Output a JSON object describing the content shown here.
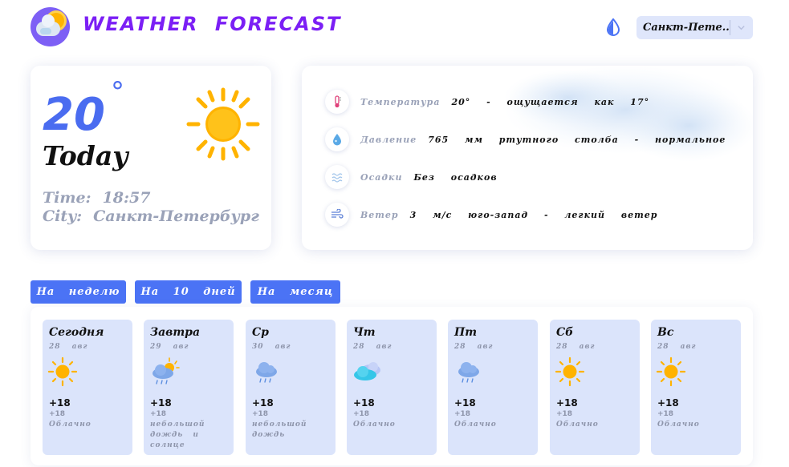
{
  "header": {
    "app_title": "WEATHER FORECAST",
    "city_selected": "Санкт-Пете...",
    "theme_icon": "droplet-half-icon"
  },
  "today": {
    "temperature": "20",
    "degree": "°",
    "label": "Today",
    "time_label": "Time:",
    "time_value": "18:57",
    "city_label": "City:",
    "city_value": "Санкт-Петербург",
    "icon": "sun-icon"
  },
  "details": [
    {
      "icon": "thermometer-icon",
      "label": "Температура",
      "value": "20° - ощущается как 17°"
    },
    {
      "icon": "pressure-drop-icon",
      "label": "Давление",
      "value": "765 мм ртутного столба - нормальное"
    },
    {
      "icon": "precipitation-icon",
      "label": "Осадки",
      "value": "Без осадков"
    },
    {
      "icon": "wind-icon",
      "label": "Ветер",
      "value": "3 м/с юго-запад - легкий ветер"
    }
  ],
  "tabs": [
    {
      "label": "На неделю"
    },
    {
      "label": "На 10 дней"
    },
    {
      "label": "На месяц"
    }
  ],
  "forecast": [
    {
      "day": "Сегодня",
      "date": "28 авг",
      "icon": "sun-icon",
      "temp": "+18",
      "min": "+18",
      "desc": "Облачно"
    },
    {
      "day": "Завтра",
      "date": "29 авг",
      "icon": "sun-rain-cloud-icon",
      "temp": "+18",
      "min": "+18",
      "desc": "небольшой дождь и солнце"
    },
    {
      "day": "Ср",
      "date": "30 авг",
      "icon": "rain-cloud-icon",
      "temp": "+18",
      "min": "+18",
      "desc": "небольшой дождь"
    },
    {
      "day": "Чт",
      "date": "28 авг",
      "icon": "cloudy-icon",
      "temp": "+18",
      "min": "+18",
      "desc": "Облачно"
    },
    {
      "day": "Пт",
      "date": "28 авг",
      "icon": "rain-cloud-icon",
      "temp": "+18",
      "min": "+18",
      "desc": "Облачно"
    },
    {
      "day": "Сб",
      "date": "28 авг",
      "icon": "sun-icon",
      "temp": "+18",
      "min": "+18",
      "desc": "Облачно"
    },
    {
      "day": "Вс",
      "date": "28 авг",
      "icon": "sun-icon",
      "temp": "+18",
      "min": "+18",
      "desc": "Облачно"
    }
  ],
  "colors": {
    "accent": "#4b73f5",
    "title": "#7b1ff5",
    "card_day": "#dbe4fb",
    "sun": "#ffb300",
    "muted_text": "#9aa2b8"
  }
}
